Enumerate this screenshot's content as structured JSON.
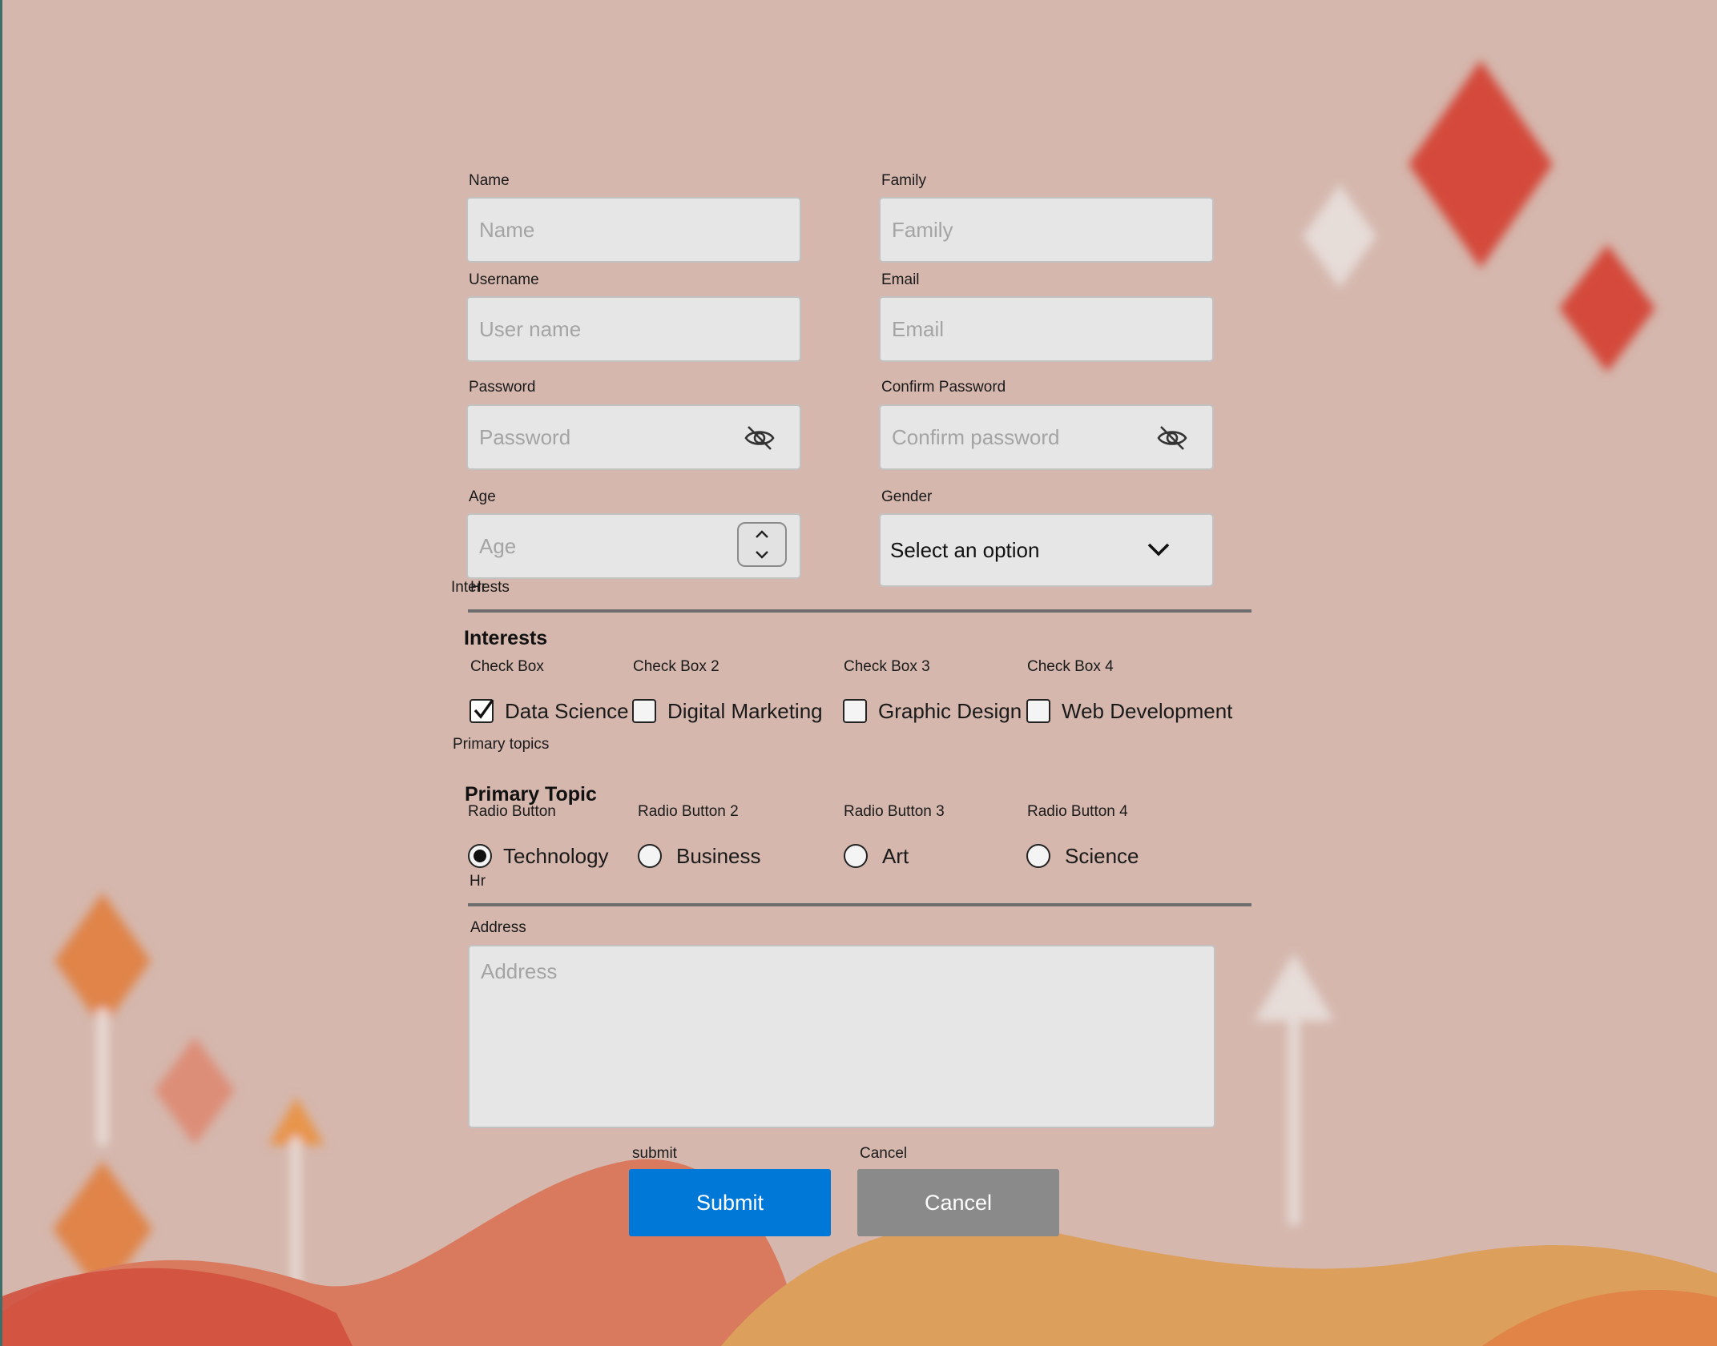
{
  "form": {
    "name": {
      "label": "Name",
      "placeholder": "Name"
    },
    "family": {
      "label": "Family",
      "placeholder": "Family"
    },
    "username": {
      "label": "Username",
      "placeholder": "User name"
    },
    "email": {
      "label": "Email",
      "placeholder": "Email"
    },
    "password": {
      "label": "Password",
      "placeholder": "Password",
      "icon": "eye-off-icon"
    },
    "confirm_password": {
      "label": "Confirm Password",
      "placeholder": "Confirm password",
      "icon": "eye-off-icon"
    },
    "age": {
      "label": "Age",
      "placeholder": "Age"
    },
    "gender": {
      "label": "Gender",
      "value": "Select an option",
      "icon": "chevron-down-icon"
    },
    "hr_label_1": "Interests",
    "hr_label_1_overlap": "Hr",
    "interests": {
      "title": "Interests",
      "items": [
        {
          "label": "Check Box",
          "text": "Data Science",
          "checked": true
        },
        {
          "label": "Check Box 2",
          "text": "Digital Marketing",
          "checked": false
        },
        {
          "label": "Check Box 3",
          "text": "Graphic Design",
          "checked": false
        },
        {
          "label": "Check Box 4",
          "text": "Web Development",
          "checked": false
        }
      ]
    },
    "primary_topics_label": "Primary topics",
    "primary_topic": {
      "title": "Primary Topic",
      "items": [
        {
          "label": "Radio Button",
          "text": "Technology",
          "selected": true
        },
        {
          "label": "Radio Button 2",
          "text": "Business",
          "selected": false
        },
        {
          "label": "Radio Button 3",
          "text": "Art",
          "selected": false
        },
        {
          "label": "Radio Button 4",
          "text": "Science",
          "selected": false
        }
      ]
    },
    "hr_label_2": "Hr",
    "address": {
      "label": "Address",
      "placeholder": "Address"
    },
    "submit": {
      "caption": "submit",
      "label": "Submit",
      "color": "#0078d7"
    },
    "cancel": {
      "caption": "Cancel",
      "label": "Cancel",
      "color": "#8a8a8a"
    }
  }
}
